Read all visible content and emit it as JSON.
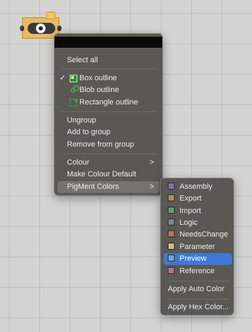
{
  "menu": {
    "select_all": "Select all",
    "box_outline": "Box outline",
    "blob_outline": "Blob outline",
    "rectangle_outline": "Rectangle outline",
    "ungroup": "Ungroup",
    "add_to_group": "Add to group",
    "remove_from_group": "Remove from group",
    "colour": "Colour",
    "make_colour_default": "Make Colour Default",
    "pigment_colors": "PigMent Colors",
    "check_glyph": "✓",
    "chevron_glyph": ">"
  },
  "submenu": {
    "items": [
      {
        "label": "Assembly",
        "color": "#8a6fb0"
      },
      {
        "label": "Export",
        "color": "#b08a52"
      },
      {
        "label": "Import",
        "color": "#58a86a"
      },
      {
        "label": "Logic",
        "color": "#7a8a84"
      },
      {
        "label": "NeedsChange",
        "color": "#c07060"
      },
      {
        "label": "Parameter",
        "color": "#c8bf72"
      },
      {
        "label": "Preview",
        "color": "#6fa2e6"
      },
      {
        "label": "Reference",
        "color": "#b87098"
      }
    ],
    "apply_auto": "Apply Auto Color",
    "apply_hex": "Apply Hex Color..."
  },
  "colors": {
    "selection": "#3e78d6",
    "menu_bg": "#56544e",
    "component": "#e9b960"
  }
}
